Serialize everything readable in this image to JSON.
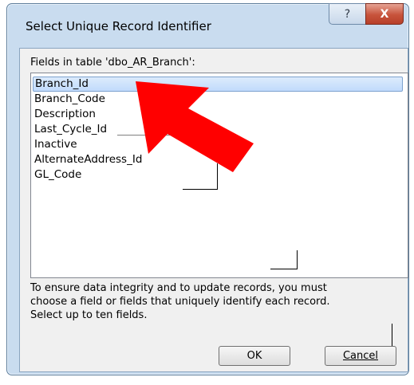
{
  "window": {
    "title": "Select Unique Record Identifier",
    "help_label": "?",
    "close_label": "X"
  },
  "dialog": {
    "fields_label": "Fields in table 'dbo_AR_Branch':",
    "fields": [
      "Branch_Id",
      "Branch_Code",
      "Description",
      "Last_Cycle_Id",
      "Inactive",
      "AlternateAddress_Id",
      "GL_Code"
    ],
    "selected_index": 0,
    "help_lines": [
      "To ensure data integrity and to update records, you must",
      "choose a field or fields that uniquely identify each record.",
      "Select up to ten fields."
    ],
    "ok_label": "OK",
    "cancel_label": "Cancel"
  },
  "colors": {
    "arrow": "#ff0000",
    "selection_bg": "#c1dbfc",
    "frame": "#c9dcef"
  }
}
